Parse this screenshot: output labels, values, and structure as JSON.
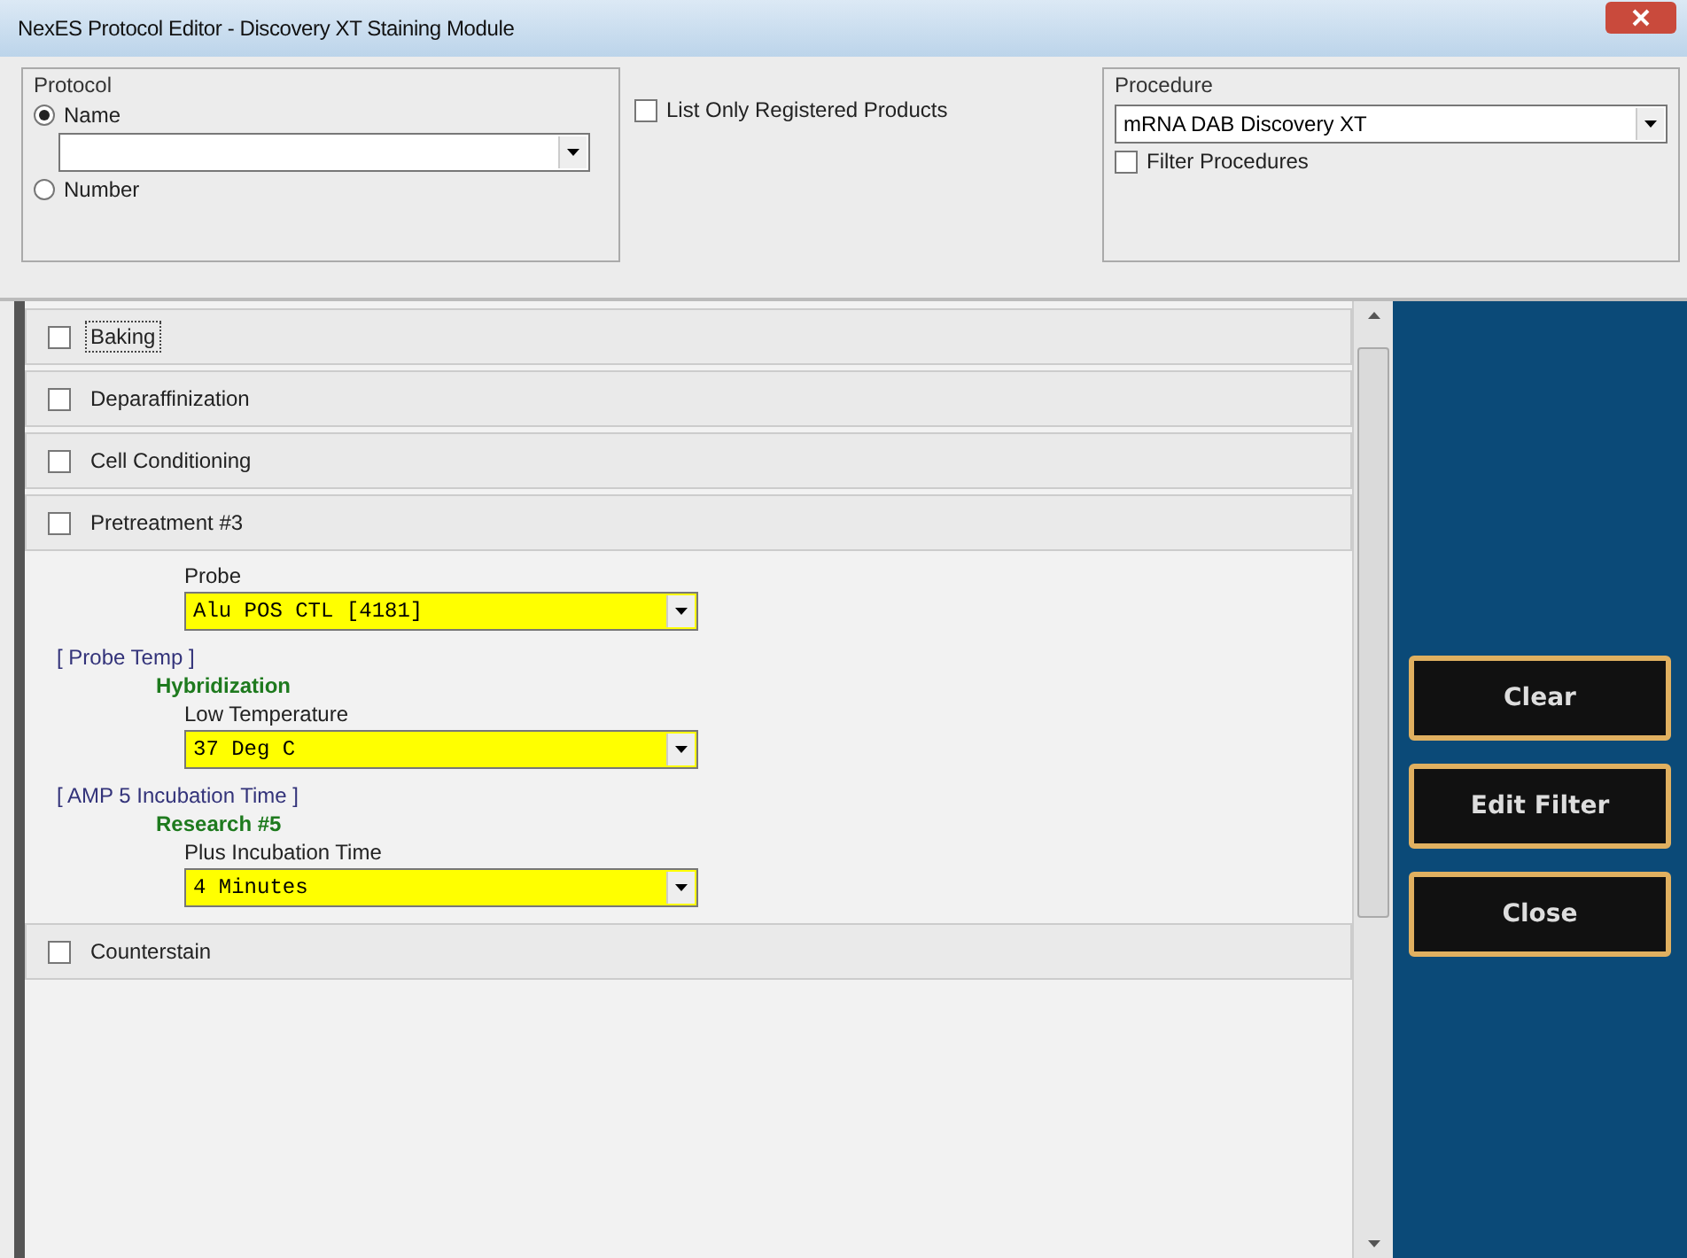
{
  "window": {
    "title": "NexES Protocol Editor - Discovery XT Staining Module"
  },
  "protocol": {
    "label": "Protocol",
    "options": [
      {
        "label": "Name",
        "selected": true
      },
      {
        "label": "Number",
        "selected": false
      }
    ]
  },
  "list_only_registered": {
    "label": "List Only Registered Products",
    "checked": false
  },
  "procedure": {
    "label": "Procedure",
    "value": "mRNA DAB Discovery XT",
    "filter": {
      "label": "Filter Procedures",
      "checked": false
    }
  },
  "steps": [
    {
      "kind": "step",
      "label": "Baking",
      "checked": false,
      "focused": true
    },
    {
      "kind": "step",
      "label": "Deparaffinization",
      "checked": false,
      "focused": false
    },
    {
      "kind": "step",
      "label": "Cell Conditioning",
      "checked": false,
      "focused": false
    },
    {
      "kind": "step",
      "label": "Pretreatment #3",
      "checked": false,
      "focused": false
    },
    {
      "kind": "detail",
      "items": [
        {
          "kind": "field",
          "label": "Probe",
          "value": "Alu POS CTL [4181]"
        },
        {
          "kind": "bracket",
          "text": "[ Probe Temp ]"
        },
        {
          "kind": "group",
          "text": "Hybridization"
        },
        {
          "kind": "field",
          "label": "Low Temperature",
          "value": "37 Deg C"
        },
        {
          "kind": "bracket",
          "text": "[ AMP 5 Incubation Time ]"
        },
        {
          "kind": "group",
          "text": "Research #5"
        },
        {
          "kind": "field",
          "label": "Plus Incubation Time",
          "value": "4 Minutes"
        }
      ]
    },
    {
      "kind": "step",
      "label": "Counterstain",
      "checked": false,
      "focused": false
    }
  ],
  "buttons": [
    {
      "label": "Clear"
    },
    {
      "label": "Edit Filter"
    },
    {
      "label": "Close"
    }
  ]
}
